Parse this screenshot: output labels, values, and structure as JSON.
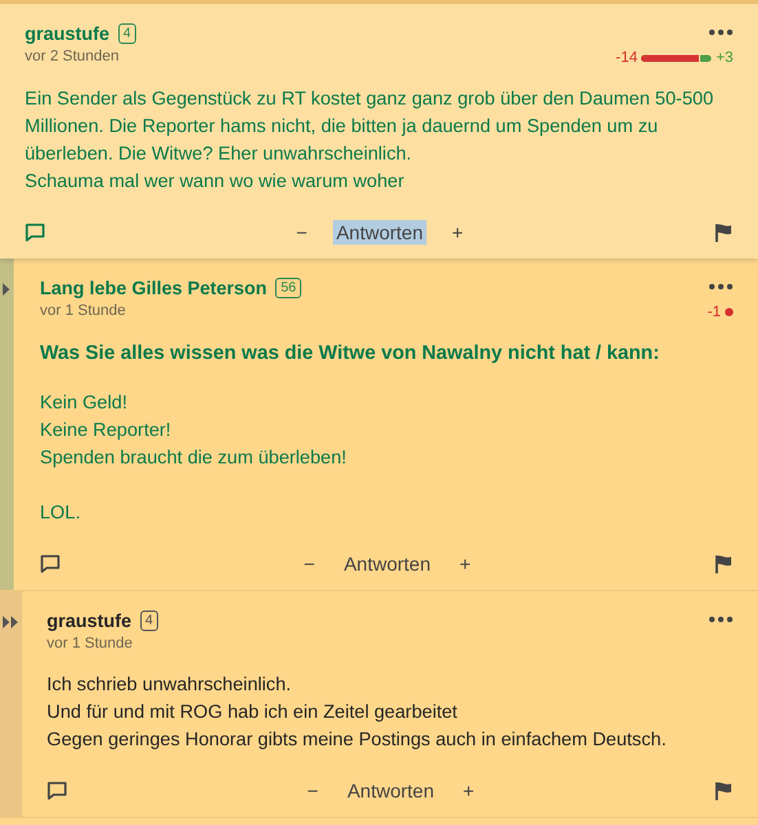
{
  "posts": [
    {
      "author": "graustufe",
      "badge": "4",
      "time": "vor 2 Stunden",
      "unread": true,
      "rating": {
        "kind": "bar",
        "negative": "-14",
        "positive": "+3",
        "level": 0.82
      },
      "blocks": [
        {
          "kind": "lines",
          "lines": [
            "Ein Sender als Gegenstück zu RT kostet ganz ganz grob über den Daumen 50-500 Millionen. Die Reporter hams nicht, die bitten ja dauernd um Spenden um zu überleben. Die Witwe? Eher unwahrscheinlich.",
            "Schauma mal wer wann wo wie warum woher"
          ]
        }
      ],
      "actions": {
        "minus": "−",
        "reply": "Antworten",
        "plus": "+",
        "reply_highlighted": true
      },
      "children": [
        {
          "author": "Lang lebe Gilles Peterson",
          "badge": "56",
          "time": "vor 1 Stunde",
          "unread": true,
          "rating": {
            "kind": "dot",
            "negative": "-1"
          },
          "blocks": [
            {
              "kind": "heading",
              "lines": [
                "Was Sie alles wissen was die Witwe von Nawalny nicht hat / kann:"
              ]
            },
            {
              "kind": "lines",
              "lines": [
                "Kein Geld!",
                "Keine Reporter!",
                "Spenden braucht die zum überleben!"
              ]
            },
            {
              "kind": "lines",
              "lines": [
                "LOL."
              ]
            }
          ],
          "actions": {
            "minus": "−",
            "reply": "Antworten",
            "plus": "+",
            "reply_highlighted": false
          },
          "children": [
            {
              "author": "graustufe",
              "badge": "4",
              "time": "vor 1 Stunde",
              "unread": false,
              "blocks": [
                {
                  "kind": "lines",
                  "lines": [
                    "Ich schrieb unwahrscheinlich.",
                    "Und für und mit ROG hab ich ein Zeitel gearbeitet",
                    "Gegen geringes Honorar gibts meine Postings auch in einfachem Deutsch."
                  ]
                }
              ],
              "actions": {
                "minus": "−",
                "reply": "Antworten",
                "plus": "+",
                "reply_highlighted": false
              }
            }
          ]
        }
      ]
    }
  ]
}
